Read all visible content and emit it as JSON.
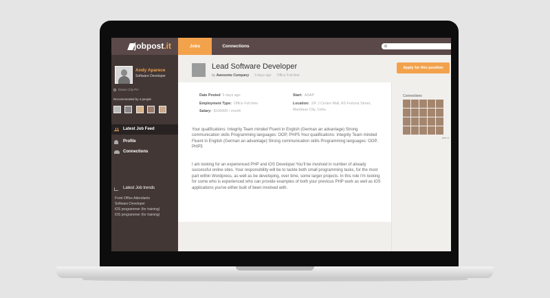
{
  "nav": {
    "logo": "jobpost",
    "logo_tld": ".it",
    "tabs": [
      "Jobs",
      "Connections"
    ],
    "active_tab": "Jobs",
    "search_placeholder": ""
  },
  "sidebar": {
    "profile": {
      "name": "Andy Aparece",
      "title": "Software Developer",
      "location": "Davao City PH"
    },
    "recommended": "Recommended by 4 people",
    "menu": [
      "Latest Job Feed",
      "Profile",
      "Connections"
    ],
    "active_menu": "Latest Job Feed",
    "trends_title": "Latest Job trends",
    "trends": [
      "Front Office Attendants",
      "Software Developer",
      "iOS programmer (for training)",
      "iOS programmer (for training)"
    ]
  },
  "job": {
    "title": "Lead Software Developer",
    "by": "by",
    "company": "Awesome Company",
    "posted_ago": "3 days ago",
    "employment": "Office Full time",
    "apply_label": "Apply for this position",
    "date_posted_label": "Date Posted",
    "date_posted_value": "5 days ago",
    "employment_type_label": "Employment Type:",
    "employment_type_value": "Office Full time",
    "salary_label": "Salary:",
    "salary_value": "$100000 / month",
    "start_label": "Start:",
    "start_value": "ASAP",
    "location_label": "Location:",
    "location_value_1": "2/F J Centre Mall, AS Fortuna Street,",
    "location_value_2": "Mandaue City, Cebu",
    "qualifications": "Your qualifications: Integrity Team minded Fluent in English (German an advantage) Strong communication skills Programming languages: OOP, PHP5 Your qualifications: Integrity Team minded Fluent in English (German an advantage) Strong communication skills Programming languages: OOP, PHP5",
    "description": "I am looking for an experienced PHP and iOS Developer.You'll be involved in number of already successful online sites. Your responsibility will be to tackle both small programming tasks, for the most part within Wordpress, as well as be developing, over time, some larger projects. In this role I'm looking for some who is experienced who can provide examples of both your previous PHP work as well as iOS applications you've either built of been involved with."
  },
  "connections": {
    "title": "Connections",
    "see_all": "see a"
  }
}
